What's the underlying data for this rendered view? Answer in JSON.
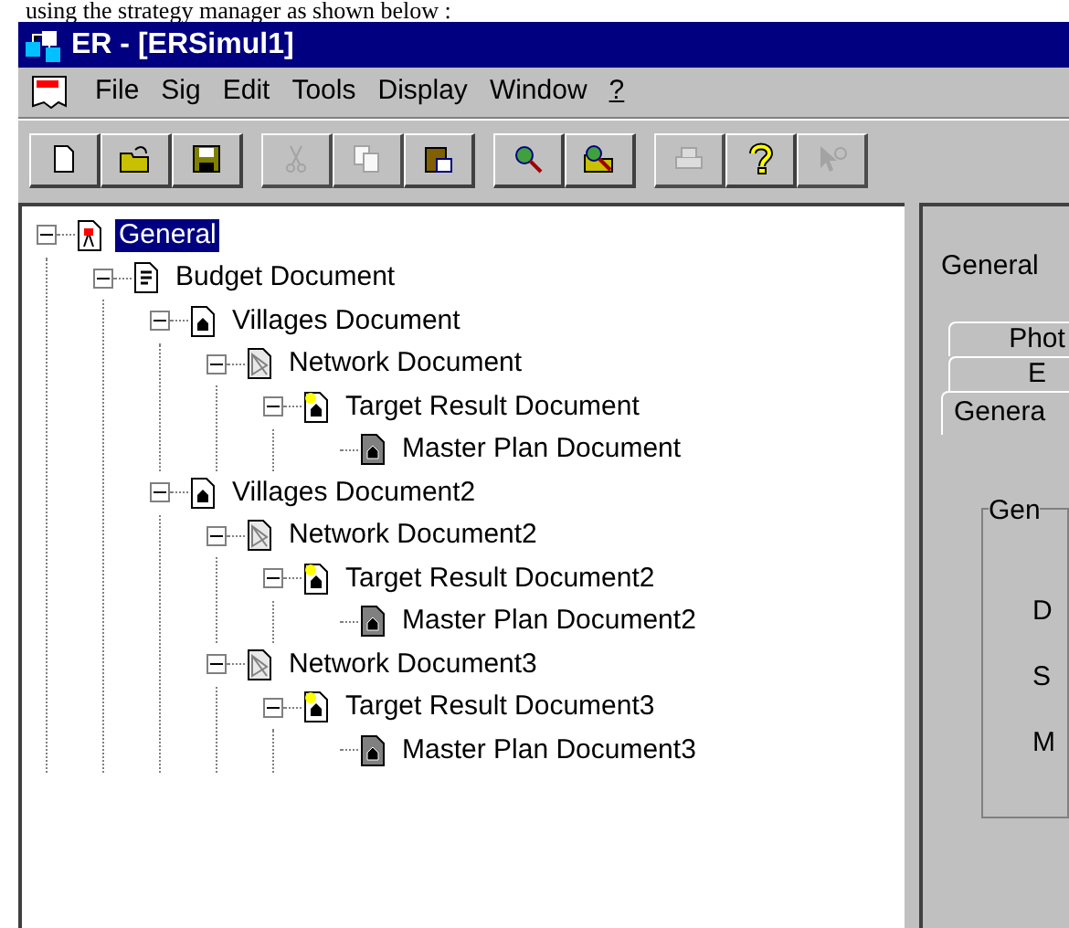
{
  "caption": "using the strategy manager as shown below :",
  "window": {
    "title": "ER - [ERSimul1]"
  },
  "menu": [
    {
      "label": "File",
      "underline": false
    },
    {
      "label": "Sig",
      "underline": false
    },
    {
      "label": "Edit",
      "underline": false
    },
    {
      "label": "Tools",
      "underline": false
    },
    {
      "label": "Display",
      "underline": false
    },
    {
      "label": "Window",
      "underline": false
    },
    {
      "label": "?",
      "underline": true
    }
  ],
  "toolbar": [
    [
      {
        "kind": "new",
        "disabled": false
      },
      {
        "kind": "open",
        "disabled": false
      },
      {
        "kind": "save",
        "disabled": false
      }
    ],
    [
      {
        "kind": "cut",
        "disabled": true
      },
      {
        "kind": "copy",
        "disabled": true
      },
      {
        "kind": "paste",
        "disabled": false
      }
    ],
    [
      {
        "kind": "zoom",
        "disabled": false
      },
      {
        "kind": "zoom-open",
        "disabled": false
      }
    ],
    [
      {
        "kind": "print",
        "disabled": true
      },
      {
        "kind": "help",
        "disabled": false
      },
      {
        "kind": "context-help",
        "disabled": true
      }
    ]
  ],
  "tree": [
    {
      "label": "General",
      "kind": "general",
      "selected": true,
      "expanded": true,
      "children": [
        {
          "label": "Budget Document",
          "kind": "budget",
          "selected": false,
          "expanded": true,
          "children": [
            {
              "label": "Villages Document",
              "kind": "villages",
              "selected": false,
              "expanded": true,
              "children": [
                {
                  "label": "Network Document",
                  "kind": "network",
                  "selected": false,
                  "expanded": true,
                  "children": [
                    {
                      "label": "Target Result Document",
                      "kind": "target",
                      "selected": false,
                      "expanded": true,
                      "children": [
                        {
                          "label": "Master Plan Document",
                          "kind": "master",
                          "selected": false
                        }
                      ]
                    }
                  ]
                }
              ]
            },
            {
              "label": "Villages Document2",
              "kind": "villages",
              "selected": false,
              "expanded": true,
              "children": [
                {
                  "label": "Network Document2",
                  "kind": "network",
                  "selected": false,
                  "expanded": true,
                  "children": [
                    {
                      "label": "Target Result Document2",
                      "kind": "target",
                      "selected": false,
                      "expanded": true,
                      "children": [
                        {
                          "label": "Master Plan Document2",
                          "kind": "master",
                          "selected": false
                        }
                      ]
                    }
                  ]
                },
                {
                  "label": "Network Document3",
                  "kind": "network",
                  "selected": false,
                  "expanded": true,
                  "children": [
                    {
                      "label": "Target Result Document3",
                      "kind": "target",
                      "selected": false,
                      "expanded": true,
                      "children": [
                        {
                          "label": "Master Plan Document3",
                          "kind": "master",
                          "selected": false
                        }
                      ]
                    }
                  ]
                }
              ]
            }
          ]
        }
      ]
    }
  ],
  "panel": {
    "heading": "General",
    "tabs": [
      {
        "label": "Phot",
        "selected": false
      },
      {
        "label": "E",
        "selected": false
      },
      {
        "label": "Genera",
        "selected": true
      }
    ],
    "group": {
      "title": "Gen",
      "labels": [
        "D",
        "S",
        "M"
      ]
    }
  }
}
